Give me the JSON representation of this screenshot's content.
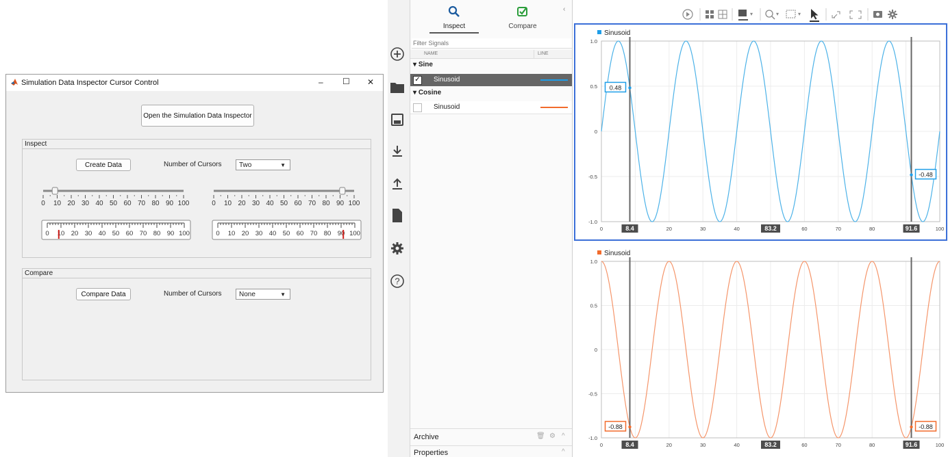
{
  "app": {
    "title": "Simulation Data Inspector Cursor Control",
    "open_button": "Open the Simulation Data Inspector",
    "inspect": {
      "title": "Inspect",
      "create_button": "Create Data",
      "cursors_label": "Number of Cursors",
      "cursors_value": "Two",
      "slider_ticks": [
        "0",
        "10",
        "20",
        "30",
        "40",
        "50",
        "60",
        "70",
        "80",
        "90",
        "100"
      ],
      "slider1_value": 8.4,
      "slider2_value": 91.6,
      "gauge1_value": 8.4,
      "gauge2_value": 91.6
    },
    "compare": {
      "title": "Compare",
      "compare_button": "Compare Data",
      "cursors_label": "Number of Cursors",
      "cursors_value": "None"
    },
    "window_controls": {
      "minimize": "–",
      "maximize": "☐",
      "close": "✕"
    }
  },
  "sdi": {
    "tabs": [
      {
        "label": "Inspect"
      },
      {
        "label": "Compare"
      }
    ],
    "filter_placeholder": "Filter Signals",
    "table_headers": {
      "name": "NAME",
      "line": "LINE"
    },
    "groups": [
      {
        "label": "Sine",
        "signal": "Sinusoid",
        "checked": true,
        "color": "#1f9ee8"
      },
      {
        "label": "Cosine",
        "signal": "Sinusoid",
        "checked": false,
        "color": "#f26b2c"
      }
    ],
    "archive_label": "Archive",
    "properties_label": "Properties",
    "sidebar_icons": [
      "add-icon",
      "folder-icon",
      "save-icon",
      "import-icon",
      "export-icon",
      "document-icon",
      "gear-icon",
      "help-icon"
    ]
  },
  "chart_data": [
    {
      "type": "line",
      "title": "Sinusoid",
      "series": [
        {
          "name": "Sinusoid",
          "function": "sin(2*pi*t/20)",
          "color": "#4cb2e8"
        }
      ],
      "xlim": [
        0,
        100
      ],
      "ylim": [
        -1.0,
        1.0
      ],
      "xticks": [
        "0",
        "10",
        "20",
        "30",
        "40",
        "50",
        "60",
        "70",
        "80",
        "90",
        "100"
      ],
      "yticks": [
        "1.0",
        "0.5",
        "0",
        "-0.5",
        "-1.0"
      ],
      "cursors": [
        8.4,
        91.6
      ],
      "cursor_delta_label": "83.2",
      "cursor_value_labels": [
        "0.48",
        "-0.48"
      ],
      "grid": true
    },
    {
      "type": "line",
      "title": "Sinusoid",
      "series": [
        {
          "name": "Sinusoid",
          "function": "cos(2*pi*t/20)",
          "color": "#f5956a"
        }
      ],
      "xlim": [
        0,
        100
      ],
      "ylim": [
        -1.0,
        1.0
      ],
      "xticks": [
        "0",
        "10",
        "20",
        "30",
        "40",
        "50",
        "60",
        "70",
        "80",
        "90",
        "100"
      ],
      "yticks": [
        "1.0",
        "0.5",
        "0",
        "-0.5",
        "-1.0"
      ],
      "cursors": [
        8.4,
        91.6
      ],
      "cursor_delta_label": "83.2",
      "cursor_value_labels": [
        "-0.88",
        "-0.88"
      ],
      "grid": true
    }
  ]
}
